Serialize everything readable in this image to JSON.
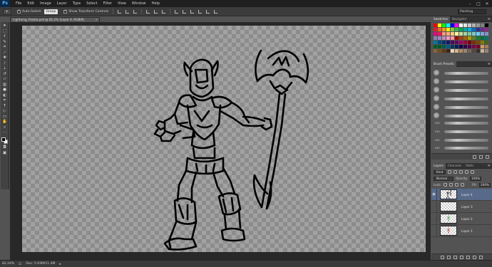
{
  "app": {
    "logo": "Ps"
  },
  "menu": [
    "File",
    "Edit",
    "Image",
    "Layer",
    "Type",
    "Select",
    "Filter",
    "View",
    "Window",
    "Help"
  ],
  "options": {
    "auto_select_label": "Auto-Select:",
    "auto_select_value": "Group",
    "transform_label": "Show Transform Controls",
    "workspace": "Painting"
  },
  "document": {
    "tab_title": "Lightning_Fokala.psd @ 82.2% (Layer 4, RGB/8)",
    "zoom": "82.24%",
    "doc_info": "Doc: 5.93M/11.4M"
  },
  "swatches_panel": {
    "tabs": [
      "Swatches",
      "Navigator"
    ]
  },
  "swatch_colors": [
    "#ff0000",
    "#ffff00",
    "#00ff00",
    "#00ffff",
    "#0000ff",
    "#ff00ff",
    "#ffffff",
    "#e6e6e6",
    "#cccccc",
    "#b3b3b3",
    "#999999",
    "#808080",
    "#000000",
    "#ed1c24",
    "#f26522",
    "#f7941d",
    "#fff200",
    "#8dc63f",
    "#39b54a",
    "#00a651",
    "#00a99d",
    "#00aeef",
    "#0072bc",
    "#2e3192",
    "#662d91",
    "#92278f",
    "#ec008c",
    "#ed145b",
    "#f69679",
    "#f9ad81",
    "#fdc68a",
    "#fff79a",
    "#c4df9b",
    "#a3d39c",
    "#82ca9d",
    "#7accc8",
    "#6dcff6",
    "#7da7d9",
    "#8393ca",
    "#8781bd",
    "#a186be",
    "#bd8cbf",
    "#f49ac1",
    "#f5989d",
    "#9e0b0f",
    "#a0410d",
    "#a36209",
    "#aba000",
    "#598527",
    "#197b30",
    "#007236",
    "#00746b",
    "#0076a3",
    "#004a80",
    "#003471",
    "#1b1464",
    "#440e62",
    "#630460",
    "#9e005d",
    "#9e0039",
    "#790000",
    "#7b2e00",
    "#7d4900",
    "#827b00",
    "#406618",
    "#005e20",
    "#005826",
    "#005952",
    "#005b7f",
    "#003663",
    "#002157",
    "#0d004c",
    "#32004b",
    "#4b0049",
    "#7b0046",
    "#7a0026",
    "#c69c6d",
    "#a67c52",
    "#8c6239",
    "#754c24",
    "#603913",
    "#3c2415",
    "#e5d5bf",
    "#d3b592",
    "#b08d63",
    "#998675",
    "#736357",
    "#534741",
    "#362f2d",
    "#c7b299",
    "#998675"
  ],
  "brush_panel": {
    "title": "Brush Presets",
    "sizes": [
      "",
      "",
      "",
      "",
      "",
      "",
      "150",
      "150",
      "100",
      "150"
    ]
  },
  "layers_panel": {
    "tabs": [
      "Layers",
      "Channels",
      "Paths"
    ],
    "kind_label": "Kind",
    "blend_mode": "Normal",
    "opacity_label": "Opacity:",
    "opacity_value": "100%",
    "lock_label": "Lock:",
    "fill_label": "Fill:",
    "fill_value": "100%",
    "layers": [
      {
        "name": "Layer 4",
        "visible": true,
        "active": true
      },
      {
        "name": "Layer 3",
        "visible": false,
        "active": false
      },
      {
        "name": "Layer 2",
        "visible": false,
        "active": false
      },
      {
        "name": "Layer 1",
        "visible": false,
        "active": false
      }
    ]
  }
}
